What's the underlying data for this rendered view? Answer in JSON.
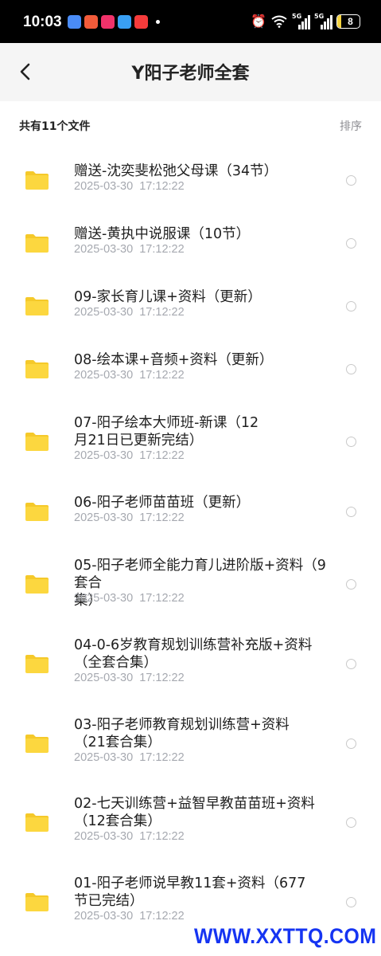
{
  "status_bar": {
    "time": "10:03",
    "app_icons": [
      {
        "name": "app-icon-1",
        "color": "#4a8cf7"
      },
      {
        "name": "app-icon-2",
        "color": "#f25b3a"
      },
      {
        "name": "app-icon-3",
        "color": "#f0326a"
      },
      {
        "name": "app-icon-4",
        "color": "#39a0f5"
      },
      {
        "name": "app-icon-5",
        "color": "#f53b3b"
      }
    ],
    "alarm_icon": "⏰",
    "wifi_icon": "wifi-icon",
    "network_1": "5G",
    "network_2": "5G",
    "battery": "8"
  },
  "header": {
    "title": "Y阳子老师全套"
  },
  "summary": {
    "count_text": "共有11个文件",
    "sort_label": "排序"
  },
  "files": [
    {
      "name": "赠送-沈奕斐松弛父母课（34节）",
      "date": "2025-03-30  17:12:22"
    },
    {
      "name": "赠送-黄执中说服课（10节）",
      "date": "2025-03-30  17:12:22"
    },
    {
      "name": "09-家长育儿课+资料（更新）",
      "date": "2025-03-30  17:12:22"
    },
    {
      "name": "08-绘本课+音频+资料（更新）",
      "date": "2025-03-30  17:12:22"
    },
    {
      "name": "07-阳子绘本大师班-新课（12月21日已更新完结）",
      "date": "2025-03-30  17:12:22"
    },
    {
      "name": "06-阳子老师苗苗班（更新）",
      "date": "2025-03-30  17:12:22"
    },
    {
      "name": "05-阳子老师全能力育儿进阶版+资料（9套合集）",
      "date": "2025-03-30  17:12:22"
    },
    {
      "name": "04-0-6岁教育规划训练营补充版+资料（全套合集）",
      "date": "2025-03-30  17:12:22"
    },
    {
      "name": "03-阳子老师教育规划训练营+资料（21套合集）",
      "date": "2025-03-30  17:12:22"
    },
    {
      "name": "02-七天训练营+益智早教苗苗班+资料（12套合集）",
      "date": "2025-03-30  17:12:22"
    },
    {
      "name": "01-阳子老师说早教11套+资料（677节已完结）",
      "date": "2025-03-30  17:12:22"
    }
  ],
  "watermark": "WWW.XXTTQ.COM",
  "colors": {
    "folder": "#fcd73f",
    "folder_tab": "#f5c92a",
    "date_text": "#a6a9b0",
    "header_bg": "#f5f5f5",
    "watermark": "#1534f2"
  }
}
